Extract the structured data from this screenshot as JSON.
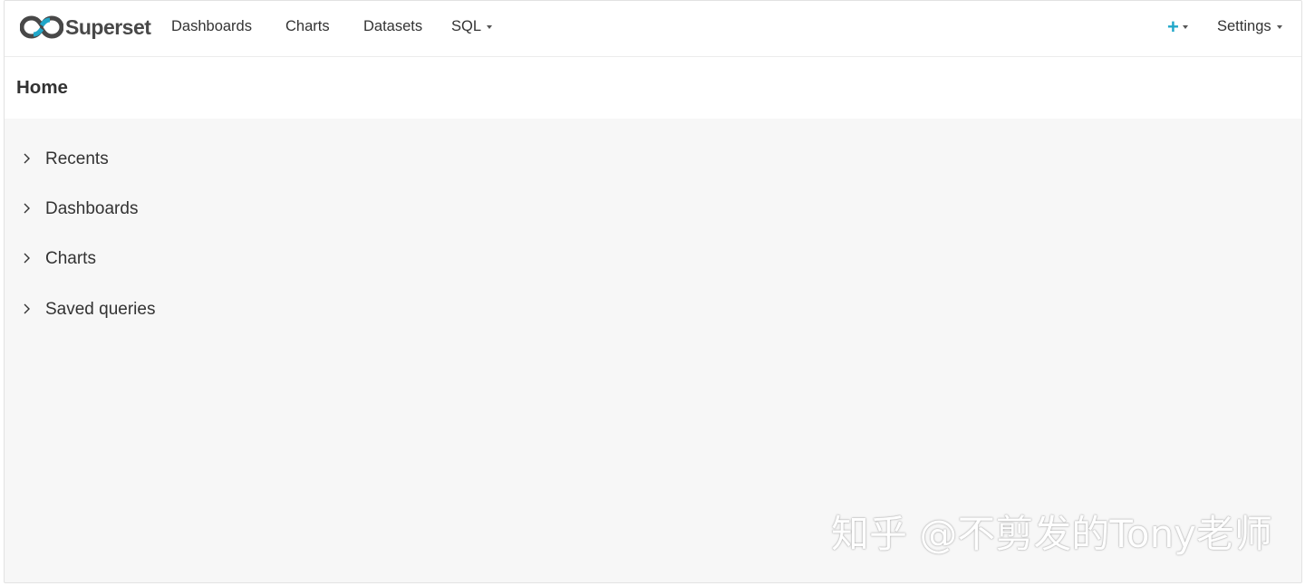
{
  "app": {
    "brand": "Superset"
  },
  "nav": {
    "items": [
      {
        "label": "Dashboards"
      },
      {
        "label": "Charts"
      },
      {
        "label": "Datasets"
      },
      {
        "label": "SQL"
      }
    ],
    "settings_label": "Settings",
    "plus_symbol": "+",
    "accent_color": "#20a7c9"
  },
  "page": {
    "title": "Home"
  },
  "sections": [
    {
      "label": "Recents",
      "icon": "chevron-right-icon"
    },
    {
      "label": "Dashboards",
      "icon": "chevron-right-icon"
    },
    {
      "label": "Charts",
      "icon": "chevron-right-icon"
    },
    {
      "label": "Saved queries",
      "icon": "chevron-right-icon"
    }
  ],
  "watermark": "知乎 @不剪发的Tony老师"
}
